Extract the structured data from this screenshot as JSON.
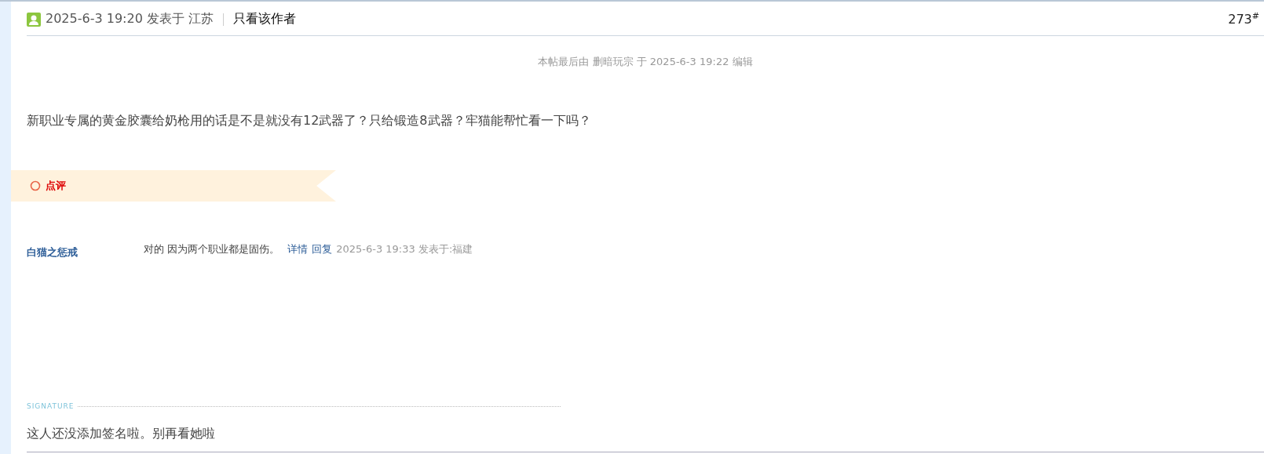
{
  "post_header": {
    "time": "2025-6-3 19:20 发表于 江苏",
    "author_only_link": "只看该作者",
    "floor": "273$^{#}$"
  },
  "edit_note": "本帖最后由 删暗玩宗 于 2025-6-3 19:22 编辑",
  "post_body": "新职业专属的黄金胶囊给奶枪用的话是不是就没有12武器了？只给锻造8武器？牢猫能帮忙看一下吗？",
  "comment_section": {
    "title": "点评",
    "comments": [
      {
        "user": "白猫之惩戒",
        "text": "对的 因为两个职业都是固伤。",
        "detail_link": "详情",
        "reply_link": "回复",
        "meta": "2025-6-3 19:33 发表于:福建"
      }
    ]
  },
  "signature": {
    "label": "SIGNATURE",
    "text": "这人还没添加签名啦。别再看她啦"
  }
}
